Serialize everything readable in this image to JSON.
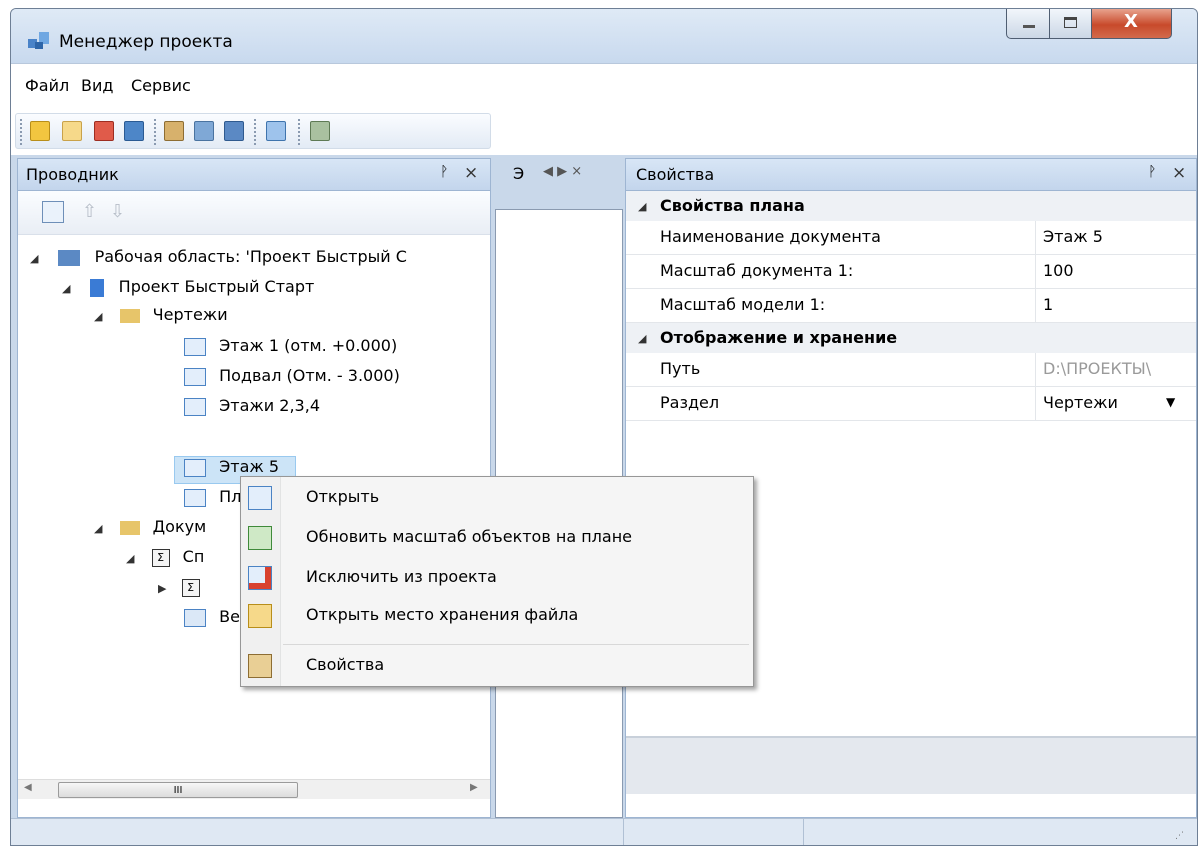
{
  "window": {
    "title": "Менеджер проекта",
    "icon": "project-manager-icon"
  },
  "menubar": {
    "items": [
      "Файл",
      "Вид",
      "Сервис"
    ]
  },
  "toolbar": {
    "icons": [
      "new-project-icon",
      "open-folder-icon",
      "close-project-icon",
      "save-icon",
      "properties-icon",
      "settings-icon",
      "workspace-icon",
      "structure-icon",
      "add-file-icon"
    ]
  },
  "explorer": {
    "title": "Проводник",
    "pin": "📌",
    "close": "×",
    "tree": [
      {
        "label": "Рабочая область: 'Проект Быстрый С",
        "icon": "workspace-icon"
      },
      {
        "label": "Проект Быстрый Старт",
        "icon": "project-icon"
      },
      {
        "label": "Чертежи",
        "icon": "folder-icon"
      },
      {
        "label": "Этаж 1 (отм. +0.000)",
        "icon": "drawing-icon"
      },
      {
        "label": "Подвал (Отм. - 3.000)",
        "icon": "drawing-icon"
      },
      {
        "label": "Этажи 2,3,4",
        "icon": "drawing-icon"
      },
      {
        "label": "Этаж 5",
        "icon": "drawing-icon",
        "selected": true
      },
      {
        "label": "Пл",
        "icon": "drawing-icon"
      },
      {
        "label": "Докум",
        "icon": "folder-icon"
      },
      {
        "label": "Сп",
        "icon": "spec-icon"
      },
      {
        "label": "",
        "icon": "spec-icon"
      },
      {
        "label": "Ве",
        "icon": "table-icon"
      }
    ],
    "scroll_grip": "III"
  },
  "middle": {
    "tab": "Э",
    "nav": "◀ ▶ ×"
  },
  "properties": {
    "title": "Свойства",
    "pin": "📌",
    "close": "×",
    "categories": [
      {
        "name": "Свойства плана",
        "rows": [
          {
            "name": "Наименование документа",
            "value": "Этаж 5"
          },
          {
            "name": "Масштаб документа 1:",
            "value": "100"
          },
          {
            "name": "Масштаб модели 1:",
            "value": "1"
          }
        ]
      },
      {
        "name": "Отображение и хранение",
        "rows": [
          {
            "name": "Путь",
            "value": "D:\\ПРОЕКТЫ\\"
          },
          {
            "name": "Раздел",
            "value": "Чертежи"
          }
        ]
      }
    ]
  },
  "context_menu": {
    "items": [
      {
        "label": "Открыть",
        "icon": "open-plan-icon"
      },
      {
        "label": "Обновить масштаб объектов на плане",
        "icon": "refresh-scale-icon"
      },
      {
        "label": "Исключить из проекта",
        "icon": "exclude-icon"
      },
      {
        "label": "Открыть место хранения файла",
        "icon": "open-location-icon"
      },
      {
        "label": "Свойства",
        "icon": "properties-icon"
      }
    ]
  },
  "colors": {
    "accent": "#3399ff",
    "selection": "#cce4f7",
    "header": "#c3d5ec"
  }
}
